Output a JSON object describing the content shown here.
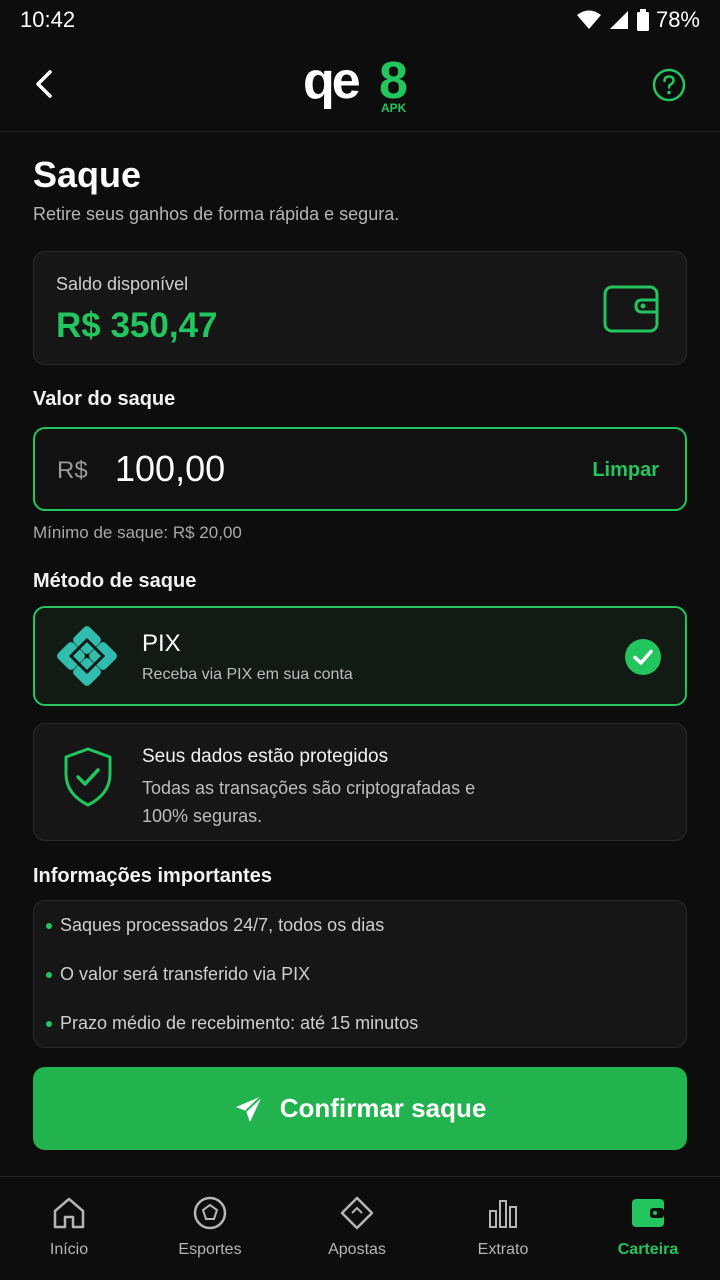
{
  "status_bar": {
    "time": "10:42",
    "battery": "78%"
  },
  "header": {
    "logo_text": "qe8",
    "logo_sub": "APK"
  },
  "page": {
    "title": "Saque",
    "subtitle": "Retire seus ganhos de forma rápida e segura."
  },
  "balance": {
    "label": "Saldo disponível",
    "value": "R$ 350,47"
  },
  "withdraw": {
    "label": "Valor do saque",
    "currency": "R$",
    "amount": "100,00",
    "clear_label": "Limpar",
    "minimum": "Mínimo de saque: R$ 20,00"
  },
  "method": {
    "label": "Método de saque",
    "name": "PIX",
    "description": "Receba via PIX em sua conta"
  },
  "security": {
    "title": "Seus dados estão protegidos",
    "description": "Todas as transações são criptografadas e 100% seguras."
  },
  "info": {
    "title": "Informações importantes",
    "items": [
      "Saques processados 24/7, todos os dias",
      "O valor será transferido via PIX",
      "Prazo médio de recebimento: até 15 minutos"
    ]
  },
  "confirm_label": "Confirmar saque",
  "nav": [
    {
      "label": "Início",
      "icon": "home-icon"
    },
    {
      "label": "Esportes",
      "icon": "ball-icon"
    },
    {
      "label": "Apostas",
      "icon": "ticket-icon"
    },
    {
      "label": "Extrato",
      "icon": "chart-icon"
    },
    {
      "label": "Carteira",
      "icon": "wallet-icon",
      "active": true
    }
  ],
  "colors": {
    "accent": "#22c55e",
    "background": "#0d0d0d",
    "card": "#161616"
  }
}
